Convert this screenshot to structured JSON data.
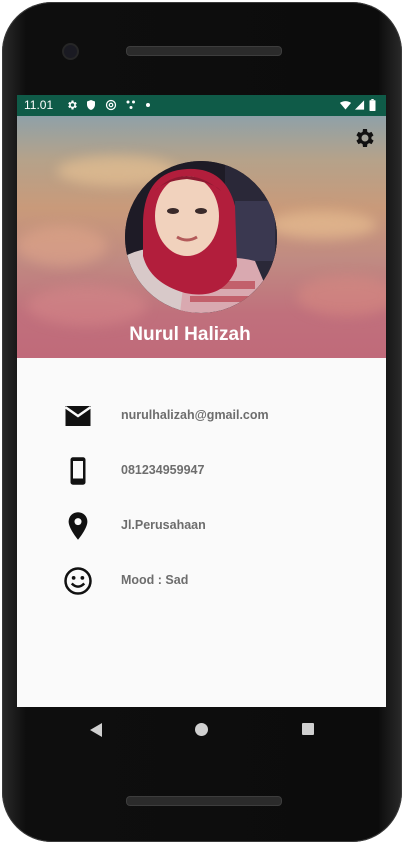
{
  "status_bar": {
    "time": "11.01",
    "icons": [
      "gear-icon",
      "shield-icon",
      "vpn-icon",
      "notification-icon",
      "dot-icon",
      "wifi-icon",
      "signal-icon",
      "battery-icon"
    ]
  },
  "profile": {
    "name": "Nurul Halizah",
    "settings_icon": "gear-icon"
  },
  "contact": [
    {
      "icon": "email-icon",
      "value": "nurulhalizah@gmail.com"
    },
    {
      "icon": "phone-icon",
      "value": "081234959947"
    },
    {
      "icon": "location-icon",
      "value": "Jl.Perusahaan"
    },
    {
      "icon": "smile-icon",
      "value": "Mood : Sad"
    }
  ],
  "nav": [
    "back-icon",
    "home-icon",
    "recent-apps-icon"
  ],
  "colors": {
    "status_bar": "#0f5b48",
    "name_text": "#ffffff",
    "info_text": "#6d6d6d",
    "background": "#fafafa"
  }
}
